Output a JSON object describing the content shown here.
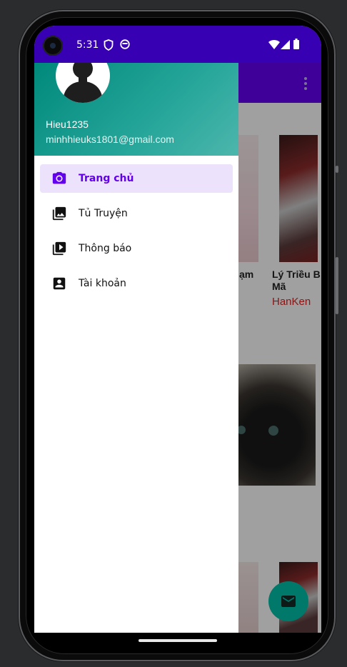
{
  "status_bar": {
    "time": "5:31",
    "icons": [
      "shield-icon",
      "face-icon",
      "wifi-icon",
      "signal-icon",
      "battery-icon"
    ]
  },
  "drawer": {
    "username": "Hieu1235",
    "email": "minhhieuks1801@gmail.com",
    "items": [
      {
        "label": "Trang chủ",
        "icon": "camera-icon",
        "active": true
      },
      {
        "label": "Tủ Truyện",
        "icon": "photo-library-icon",
        "active": false
      },
      {
        "label": "Thông báo",
        "icon": "slideshow-icon",
        "active": false
      },
      {
        "label": "Tài khoản",
        "icon": "account-box-icon",
        "active": false
      }
    ]
  },
  "background": {
    "book_titles": [
      "ạm",
      "Lý Triều B\nMã"
    ],
    "book_authors": [
      "HanKen"
    ]
  },
  "colors": {
    "status_bar": "#3700b3",
    "toolbar": "#6200ee",
    "drawer_header": "#26a69a",
    "active_item_bg": "#ece2fb",
    "active_item_text": "#6200ee",
    "fab": "#00796b",
    "author": "#dd2222"
  }
}
